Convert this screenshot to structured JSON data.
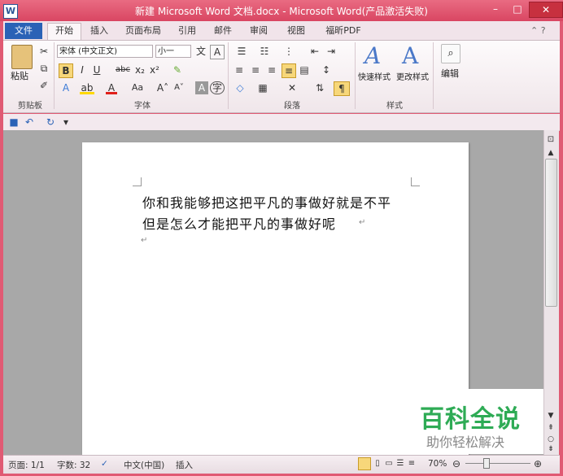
{
  "window": {
    "title": "新建 Microsoft Word 文档.docx - Microsoft Word(产品激活失败)",
    "app_icon_letter": "W",
    "controls": {
      "minimize": "–",
      "maximize": "□",
      "close": "✕"
    }
  },
  "tabs": [
    "文件",
    "开始",
    "插入",
    "页面布局",
    "引用",
    "邮件",
    "审阅",
    "视图",
    "福昕PDF"
  ],
  "ribbon": {
    "clipboard": {
      "paste_label": "粘贴",
      "group_label": "剪贴板"
    },
    "font": {
      "font_name": "宋体 (中文正文)",
      "font_size": "小一",
      "group_label": "字体",
      "buttons": [
        "B",
        "I",
        "U",
        "abc",
        "x₂",
        "x²"
      ],
      "grow": "A˄",
      "shrink": "A˅",
      "case": "Aa"
    },
    "paragraph": {
      "group_label": "段落"
    },
    "styles": {
      "quick_styles_label": "快速样式",
      "change_styles_label": "更改样式",
      "group_label": "样式"
    },
    "editing": {
      "label": "编辑"
    }
  },
  "document": {
    "lines": [
      "你和我能够把这把平凡的事做好就是不平",
      "但是怎么才能把平凡的事做好呢"
    ],
    "paragraph_mark": "↵"
  },
  "status": {
    "page": "页面: 1/1",
    "words": "字数: 32",
    "language": "中文(中国)",
    "mode": "插入",
    "zoom": "70%"
  },
  "watermark": {
    "title": "百科全说",
    "subtitle": "助你轻松解决"
  },
  "colors": {
    "title_bar": "#d94662",
    "file_tab": "#2a62b6",
    "watermark_green": "#2eab55"
  }
}
